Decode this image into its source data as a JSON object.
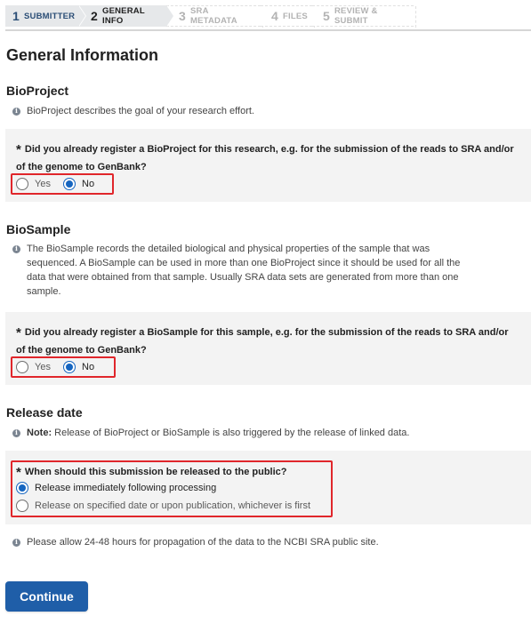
{
  "wizard": {
    "steps": [
      {
        "num": "1",
        "label": "Submitter"
      },
      {
        "num": "2",
        "label": "General Info"
      },
      {
        "num": "3",
        "label": "SRA Metadata"
      },
      {
        "num": "4",
        "label": "Files"
      },
      {
        "num": "5",
        "label": "Review & Submit"
      }
    ],
    "active_step": 2
  },
  "page": {
    "title": "General Information"
  },
  "bioproject": {
    "title": "BioProject",
    "info": "BioProject describes the goal of your research effort.",
    "question": "Did you already register a BioProject for this research, e.g. for the submission of the reads to SRA and/or of the genome to GenBank?",
    "options": [
      "Yes",
      "No"
    ],
    "selected": "No"
  },
  "biosample": {
    "title": "BioSample",
    "info": "The BioSample records the detailed biological and physical properties of the sample that was sequenced. A BioSample can be used in more than one BioProject since it should be used for all the data that were obtained from that sample. Usually SRA data sets are generated from more than one sample.",
    "question": "Did you already register a BioSample for this sample, e.g. for the submission of the reads to SRA and/or of the genome to GenBank?",
    "options": [
      "Yes",
      "No"
    ],
    "selected": "No"
  },
  "release": {
    "title": "Release date",
    "note_label": "Note:",
    "note": "Release of BioProject or BioSample is also triggered by the release of linked data.",
    "question": "When should this submission be released to the public?",
    "options": [
      "Release immediately following processing",
      "Release on specified date or upon publication, whichever is first"
    ],
    "selected": "Release immediately following processing"
  },
  "footer_info": "Please allow 24-48 hours for propagation of the data to the NCBI SRA public site.",
  "continue_label": "Continue",
  "required_marker": "*",
  "info_glyph": "i",
  "colors": {
    "accent": "#1565c0",
    "button": "#1f5ea8",
    "highlight_border": "#e0262b",
    "panel_bg": "#f3f3f3",
    "step_done": "#2b4e76"
  }
}
